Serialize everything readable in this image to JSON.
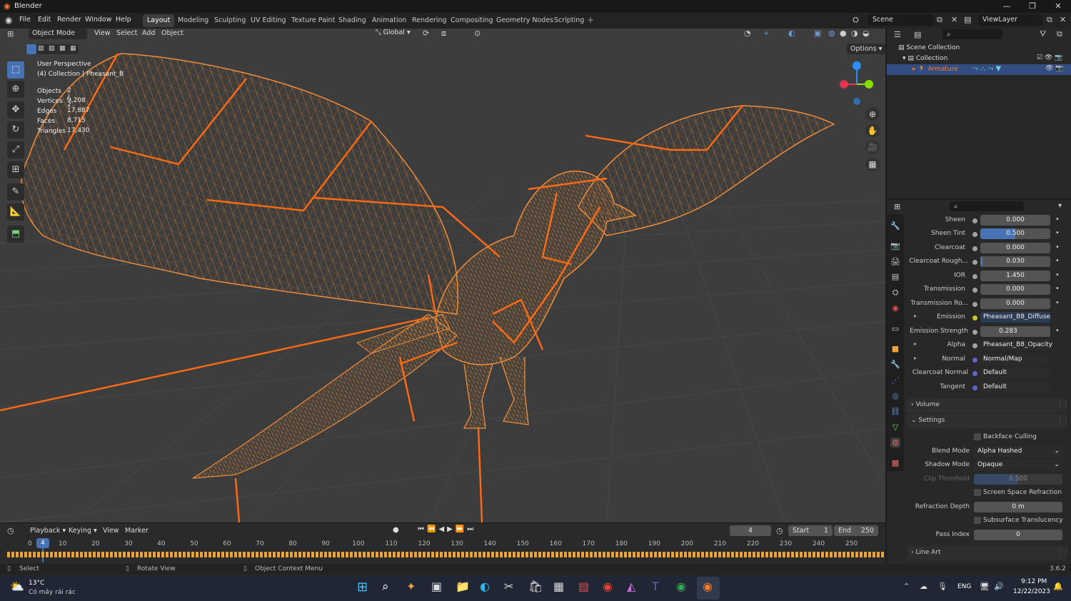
{
  "window": {
    "title": "Blender",
    "minimize": "—",
    "maximize": "❐",
    "close": "✕"
  },
  "menus": [
    "File",
    "Edit",
    "Render",
    "Window",
    "Help"
  ],
  "workspaces": [
    "Layout",
    "Modeling",
    "Sculpting",
    "UV Editing",
    "Texture Paint",
    "Shading",
    "Animation",
    "Rendering",
    "Compositing",
    "Geometry Nodes",
    "Scripting"
  ],
  "scene": {
    "name": "Scene",
    "view_layer": "ViewLayer"
  },
  "viewport_header": {
    "mode": "Object Mode",
    "menus": [
      "View",
      "Select",
      "Add",
      "Object"
    ],
    "transform": "Global",
    "options": "Options"
  },
  "overlay": {
    "perspective": "User Perspective",
    "collection": "(4) Collection | Pheasant_B",
    "stats": [
      {
        "label": "Objects",
        "value": "2 / 2"
      },
      {
        "label": "Vertices",
        "value": "9,208"
      },
      {
        "label": "Edges",
        "value": "17,887"
      },
      {
        "label": "Faces",
        "value": "8,715"
      },
      {
        "label": "Triangles",
        "value": "17,430"
      }
    ]
  },
  "outliner": {
    "root": "Scene Collection",
    "collection": "Collection",
    "object": "Armature"
  },
  "properties": {
    "rows": [
      {
        "label": "Sheen",
        "value": "0.000",
        "fill": 0
      },
      {
        "label": "Sheen Tint",
        "value": "0.500",
        "fill": 0.5
      },
      {
        "label": "Clearcoat",
        "value": "0.000",
        "fill": 0
      },
      {
        "label": "Clearcoat Rough...",
        "value": "0.030",
        "fill": 0.03
      },
      {
        "label": "IOR",
        "value": "1.450",
        "fill": 0
      },
      {
        "label": "Transmission",
        "value": "0.000",
        "fill": 0
      },
      {
        "label": "Transmission Ro...",
        "value": "0.000",
        "fill": 0
      }
    ],
    "links": [
      {
        "label": "Emission",
        "value": "Pheasant_B8_Diffuse",
        "arrow": true,
        "color": "#c7c729"
      },
      {
        "label": "Emission Strength",
        "value": "0.283",
        "arrow": false,
        "color": "#a1a1a1"
      },
      {
        "label": "Alpha",
        "value": "Pheasant_B8_Opacity",
        "arrow": true,
        "color": "#a1a1a1"
      },
      {
        "label": "Normal",
        "value": "Normal/Map",
        "arrow": true,
        "color": "#6363c7"
      },
      {
        "label": "Clearcoat Normal",
        "value": "Default",
        "arrow": false,
        "color": "#6363c7"
      },
      {
        "label": "Tangent",
        "value": "Default",
        "arrow": false,
        "color": "#6363c7"
      }
    ],
    "panels": {
      "volume": "Volume",
      "settings": "Settings",
      "line_art": "Line Art"
    },
    "settings": {
      "backface_culling": "Backface Culling",
      "blend_mode_label": "Blend Mode",
      "blend_mode": "Alpha Hashed",
      "shadow_mode_label": "Shadow Mode",
      "shadow_mode": "Opaque",
      "clip_label": "Clip Threshold",
      "clip_value": "0.500",
      "ssr": "Screen Space Refraction",
      "refraction_depth_label": "Refraction Depth",
      "refraction_depth": "0 m",
      "sss": "Subsurface Translucency",
      "pass_index_label": "Pass Index",
      "pass_index": "0"
    }
  },
  "timeline": {
    "menus": [
      "Playback",
      "Keying",
      "View",
      "Marker"
    ],
    "current_frame": "4",
    "start_label": "Start",
    "start": "1",
    "end_label": "End",
    "end": "250",
    "ticks": [
      "0",
      "10",
      "20",
      "30",
      "40",
      "50",
      "60",
      "70",
      "80",
      "90",
      "100",
      "110",
      "120",
      "130",
      "140",
      "150",
      "160",
      "170",
      "180",
      "190",
      "200",
      "210",
      "220",
      "230",
      "240",
      "250"
    ]
  },
  "status": {
    "select": "Select",
    "rotate": "Rotate View",
    "context": "Object Context Menu",
    "version": "3.6.2"
  },
  "taskbar": {
    "weather_temp": "13°C",
    "weather_desc": "Có mây rải rác",
    "lang": "ENG",
    "time": "9:12 PM",
    "date": "12/22/2023"
  }
}
